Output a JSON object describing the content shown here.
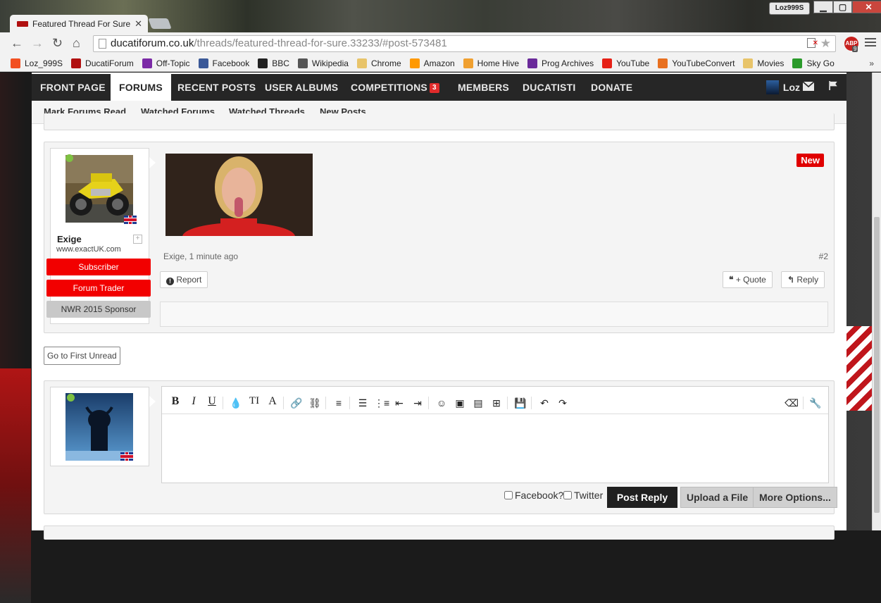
{
  "browser": {
    "tab_title": "Featured Thread For Sure",
    "profile_name": "Loz999S",
    "url_domain": "ducatiforum.co.uk",
    "url_path": "/threads/featured-thread-for-sure.33233/#post-573481",
    "abp_label": "ABP",
    "abp_count": "9",
    "bookmarks": [
      {
        "label": "Loz_999S",
        "icon": "windows-icon",
        "color": "#f25022"
      },
      {
        "label": "DucatiForum",
        "icon": "ducati-icon",
        "color": "#b01010"
      },
      {
        "label": "Off-Topic",
        "icon": "off-topic-icon",
        "color": "#7b2aa6"
      },
      {
        "label": "Facebook",
        "icon": "facebook-icon",
        "color": "#3b5998"
      },
      {
        "label": "BBC",
        "icon": "bbc-icon",
        "color": "#222222"
      },
      {
        "label": "Wikipedia",
        "icon": "wikipedia-icon",
        "color": "#555555"
      },
      {
        "label": "Chrome",
        "icon": "folder-icon",
        "color": "#e8c46a"
      },
      {
        "label": "Amazon",
        "icon": "amazon-icon",
        "color": "#ff9900"
      },
      {
        "label": "Home Hive",
        "icon": "hive-icon",
        "color": "#f0a030"
      },
      {
        "label": "Prog Archives",
        "icon": "prog-icon",
        "color": "#6a2a9a"
      },
      {
        "label": "YouTube",
        "icon": "youtube-icon",
        "color": "#e62117"
      },
      {
        "label": "YouTubeConvert",
        "icon": "convert-icon",
        "color": "#e87020"
      },
      {
        "label": "Movies",
        "icon": "folder-icon",
        "color": "#e8c46a"
      },
      {
        "label": "Sky Go",
        "icon": "wifi-icon",
        "color": "#2a9a2a"
      }
    ],
    "bookmarks_more": "»"
  },
  "nav": {
    "tabs": [
      "FRONT PAGE",
      "FORUMS",
      "RECENT POSTS",
      "USER ALBUMS",
      "COMPETITIONS",
      "MEMBERS",
      "DUCATISTI",
      "DONATE"
    ],
    "competitions_badge": "3",
    "username": "Loz"
  },
  "subnav": [
    "Mark Forums Read",
    "Watched Forums",
    "Watched Threads",
    "New Posts"
  ],
  "post": {
    "username": "Exige",
    "user_site": "www.exactUK.com",
    "titles": [
      "Subscriber",
      "Forum Trader",
      "NWR 2015 Sponsor"
    ],
    "new_badge": "New",
    "meta": "Exige, 1 minute ago",
    "post_number": "#2",
    "report_label": "Report",
    "quote_label": "+ Quote",
    "reply_label": "Reply"
  },
  "go_first_unread": "Go to First Unread",
  "editor": {
    "facebook_label": "Facebook?",
    "twitter_label": "Twitter",
    "post_reply": "Post Reply",
    "upload_file": "Upload a File",
    "more_options": "More Options..."
  },
  "colors": {
    "nav_bg": "#262626",
    "badge_red": "#e12b2b",
    "title_red": "#f20000",
    "title_grey": "#c8c8c8"
  }
}
